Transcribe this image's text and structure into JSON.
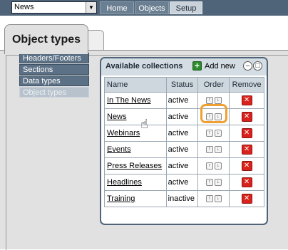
{
  "topbar": {
    "site_select": "News",
    "tabs": [
      {
        "label": "Home"
      },
      {
        "label": "Objects"
      },
      {
        "label": "Setup"
      }
    ]
  },
  "page_tab": "Object types",
  "menu": [
    {
      "label": "Headers/Footers"
    },
    {
      "label": "Sections"
    },
    {
      "label": "Data types"
    },
    {
      "label": "Object types"
    }
  ],
  "collections": {
    "title": "Available collections",
    "add_new": "Add new",
    "columns": {
      "name": "Name",
      "status": "Status",
      "order": "Order",
      "remove": "Remove"
    },
    "rows": [
      {
        "name": "In The News",
        "status": "active"
      },
      {
        "name": "News",
        "status": "active"
      },
      {
        "name": "Webinars",
        "status": "active"
      },
      {
        "name": "Events",
        "status": "active"
      },
      {
        "name": "Press Releases",
        "status": "active"
      },
      {
        "name": "Headlines",
        "status": "active"
      },
      {
        "name": "Training",
        "status": "inactive"
      }
    ]
  },
  "colors": {
    "accent": "#4f6478",
    "highlight": "#f0a030",
    "delete": "#d9221c",
    "add": "#2d8a2d"
  }
}
